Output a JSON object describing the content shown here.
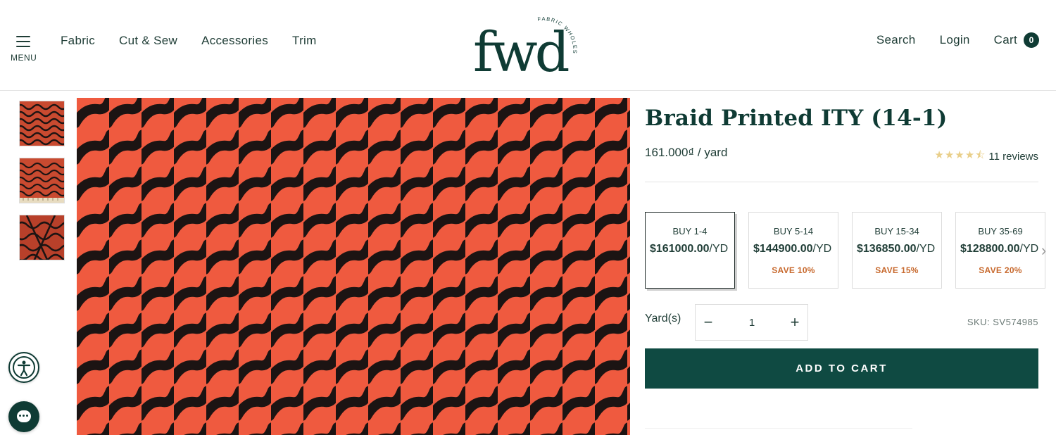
{
  "header": {
    "menu_label": "MENU",
    "nav": [
      "Fabric",
      "Cut & Sew",
      "Accessories",
      "Trim"
    ],
    "logo_text": "fwd",
    "logo_tagline": "FABRIC WHOLESALE DIRECT",
    "search_label": "Search",
    "login_label": "Login",
    "cart_label": "Cart",
    "cart_count": "0"
  },
  "gallery": {
    "thumbnails": [
      "pattern-closeup",
      "pattern-with-ruler",
      "pattern-folded"
    ],
    "colors": {
      "fabric": "#ef5a3f",
      "pattern": "#1c1413"
    }
  },
  "product": {
    "title": "Braid Printed ITY (14-1)",
    "price": "161.000₫ / yard",
    "stars": "★★★★⯪",
    "rating_value": 4.5,
    "reviews": "11 reviews",
    "tiers": [
      {
        "qty": "BUY 1-4",
        "price": "$161000.00",
        "unit": "/YD",
        "save": "",
        "selected": true
      },
      {
        "qty": "BUY 5-14",
        "price": "$144900.00",
        "unit": "/YD",
        "save": "SAVE 10%",
        "selected": false
      },
      {
        "qty": "BUY 15-34",
        "price": "$136850.00",
        "unit": "/YD",
        "save": "SAVE 15%",
        "selected": false
      },
      {
        "qty": "BUY 35-69",
        "price": "$128800.00",
        "unit": "/YD",
        "save": "SAVE 20%",
        "selected": false
      }
    ],
    "quantity_label": "Yard(s)",
    "quantity_value": "1",
    "minus": "−",
    "plus": "+",
    "sku": "SKU: SV574985",
    "add_to_cart": "ADD TO CART"
  },
  "colors": {
    "brand_green": "#0f3b34",
    "button_green": "#0f4a42",
    "save_orange": "#c7682c",
    "star_gold": "#e9cf8a"
  }
}
